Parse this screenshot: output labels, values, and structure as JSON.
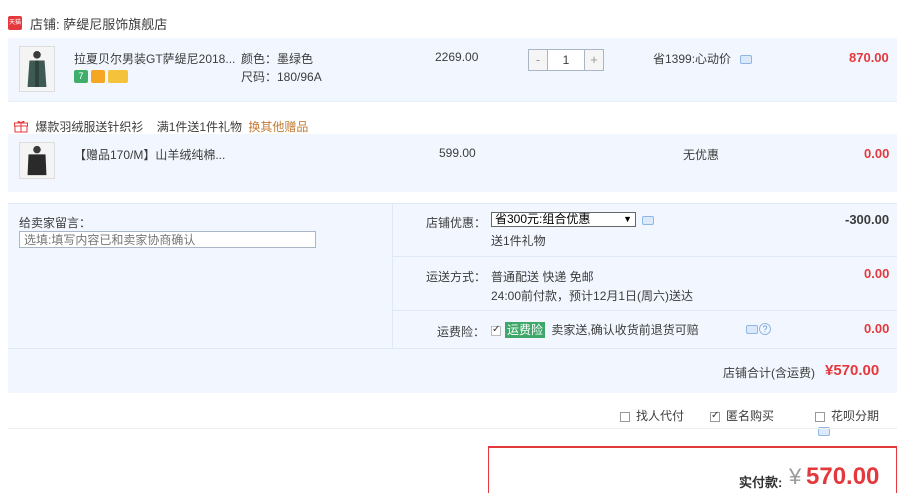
{
  "shop": {
    "icon_text": "天猫",
    "label": "店铺: 萨缇尼服饰旗舰店"
  },
  "item": {
    "title": "拉夏贝尔男装GT萨缇尼2018...",
    "color": "颜色：墨绿色",
    "size": "尺码：180/96A",
    "price": "2269.00",
    "quantity": "1",
    "qty_minus": "-",
    "qty_plus": "+",
    "discount": "省1399:心动价",
    "subtotal": "870.00"
  },
  "gift": {
    "title": "爆款羽绒服送针织衫",
    "rule": "满1件送1件礼物",
    "change_link": "换其他赠品",
    "item_title": "【赠品170/M】山羊绒纯棉...",
    "price": "599.00",
    "discount": "无优惠",
    "subtotal": "0.00"
  },
  "remark": {
    "label": "给卖家留言：",
    "placeholder": "选填:填写内容已和卖家协商确认"
  },
  "promo": {
    "label": "店铺优惠：",
    "selected": "省300元:组合优惠",
    "note": "送1件礼物",
    "amount": "-300.00"
  },
  "shipping": {
    "label": "运送方式：",
    "method": "普通配送 快递 免邮",
    "eta": "24:00前付款，预计12月1日(周六)送达",
    "amount": "0.00"
  },
  "insurance": {
    "label": "运费险：",
    "tag": "运费险",
    "desc": "卖家送,确认收货前退货可赔",
    "amount": "0.00"
  },
  "shop_total": {
    "label": "店铺合计(含运费)",
    "amount": "¥570.00"
  },
  "options": {
    "friend_pay": "找人代付",
    "anonymous": "匿名购买",
    "huabei": "花呗分期"
  },
  "pay": {
    "label": "实付款:",
    "currency": "¥",
    "amount": "570.00"
  },
  "colors": {
    "accent_red": "#e4393c",
    "panel_blue": "#f2f7ff"
  }
}
